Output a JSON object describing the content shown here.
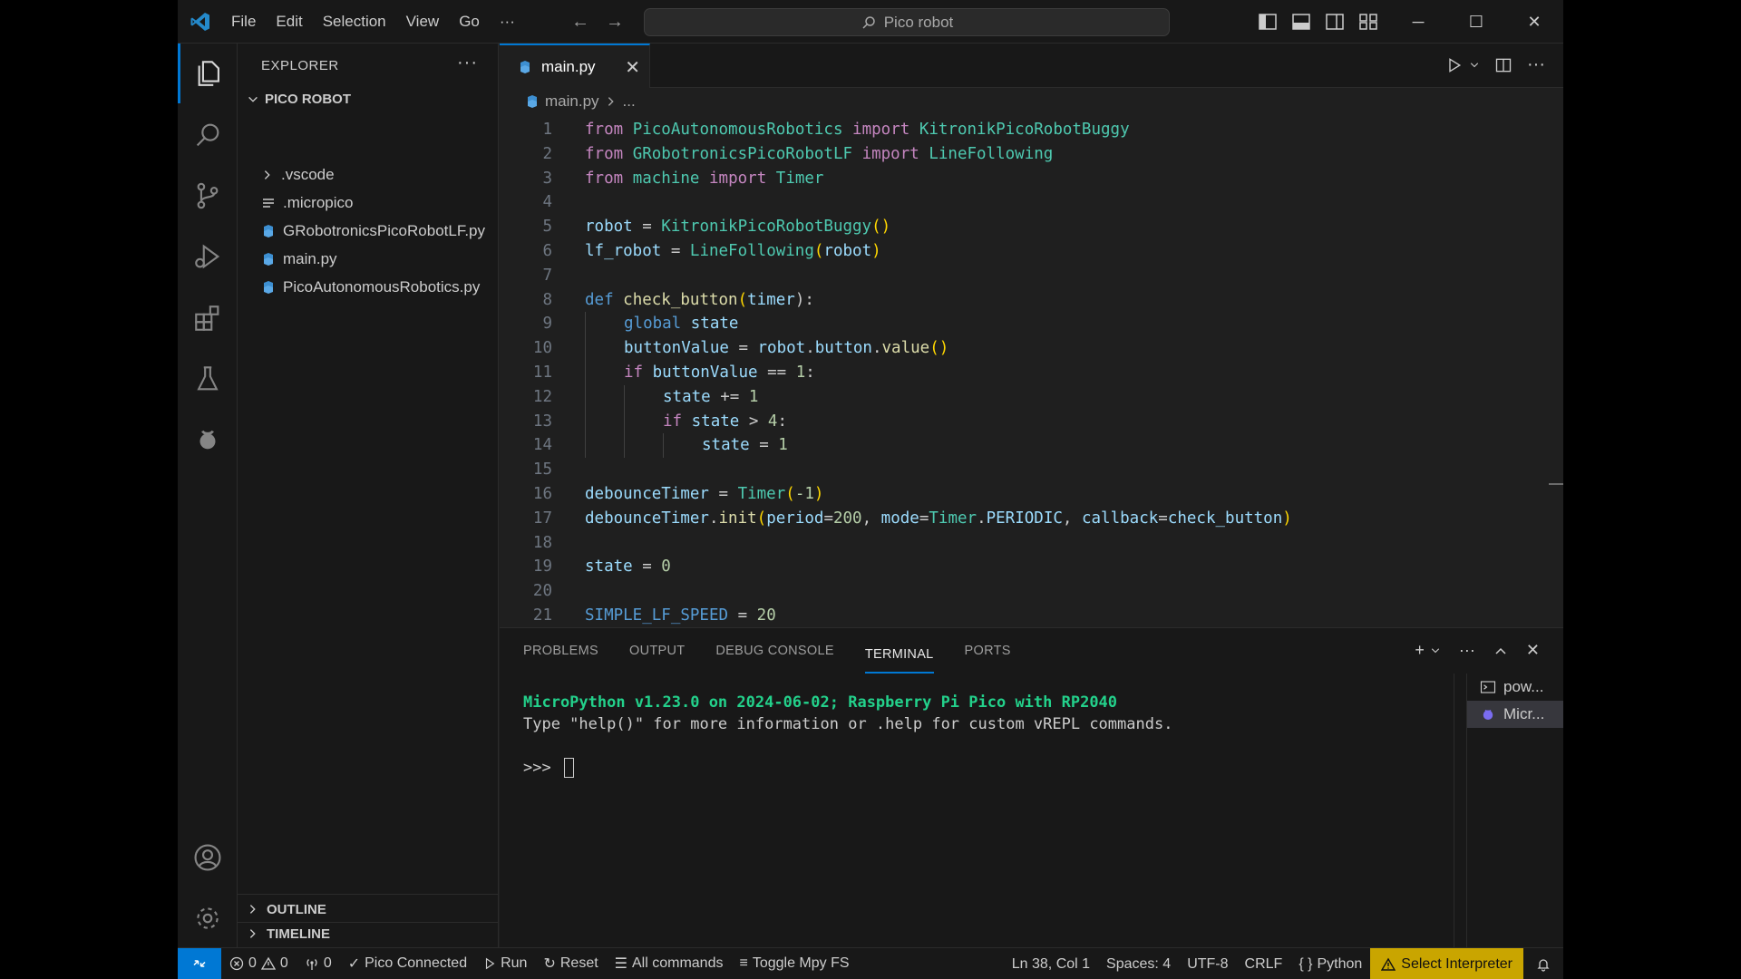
{
  "titlebar": {
    "menu": [
      "File",
      "Edit",
      "Selection",
      "View",
      "Go",
      "···"
    ],
    "search_text": "Pico robot"
  },
  "sidebar": {
    "header": "EXPLORER",
    "more": "···",
    "folder": "PICO ROBOT",
    "items": [
      {
        "label": ".vscode",
        "kind": "folder"
      },
      {
        "label": ".micropico",
        "kind": "file"
      },
      {
        "label": "GRobotronicsPicoRobotLF.py",
        "kind": "python"
      },
      {
        "label": "main.py",
        "kind": "python"
      },
      {
        "label": "PicoAutonomousRobotics.py",
        "kind": "python"
      }
    ],
    "outline": "OUTLINE",
    "timeline": "TIMELINE"
  },
  "editor": {
    "tab_label": "main.py",
    "breadcrumb_file": "main.py",
    "breadcrumb_more": "...",
    "line_numbers": [
      "1",
      "2",
      "3",
      "4",
      "5",
      "6",
      "7",
      "8",
      "9",
      "10",
      "11",
      "12",
      "13",
      "14",
      "15",
      "16",
      "17",
      "18",
      "19",
      "20",
      "21"
    ],
    "code": {
      "l1": [
        "from",
        "PicoAutonomousRobotics",
        "import",
        "KitronikPicoRobotBuggy"
      ],
      "l2": [
        "from",
        "GRobotronicsPicoRobotLF",
        "import",
        "LineFollowing"
      ],
      "l3": [
        "from",
        "machine",
        "import",
        "Timer"
      ],
      "l5": [
        "robot",
        " = ",
        "KitronikPicoRobotBuggy",
        "()"
      ],
      "l6": [
        "lf_robot",
        " = ",
        "LineFollowing",
        "(",
        "robot",
        ")"
      ],
      "l8": [
        "def",
        "check_button",
        "(",
        "timer",
        "):"
      ],
      "l9": [
        "global",
        "state"
      ],
      "l10": [
        "buttonValue",
        " = ",
        "robot",
        ".",
        "button",
        ".",
        "value",
        "()"
      ],
      "l11": [
        "if",
        "buttonValue",
        " == ",
        "1",
        ":"
      ],
      "l12": [
        "state",
        " += ",
        "1"
      ],
      "l13": [
        "if",
        "state",
        " > ",
        "4",
        ":"
      ],
      "l14": [
        "state",
        " = ",
        "1"
      ],
      "l16": [
        "debounceTimer",
        " = ",
        "Timer",
        "(",
        "-1",
        ")"
      ],
      "l17": [
        "debounceTimer",
        ".",
        "init",
        "(",
        "period",
        "=",
        "200",
        ", ",
        "mode",
        "=",
        "Timer",
        ".",
        "PERIODIC",
        ", ",
        "callback",
        "=",
        "check_button",
        ")"
      ],
      "l19": [
        "state",
        " = ",
        "0"
      ],
      "l21": [
        "SIMPLE_LF_SPEED",
        " = ",
        "20"
      ]
    }
  },
  "panel": {
    "tabs": [
      "PROBLEMS",
      "OUTPUT",
      "DEBUG CONSOLE",
      "TERMINAL",
      "PORTS"
    ],
    "active_tab": "TERMINAL",
    "terminal_line1": "MicroPython v1.23.0 on 2024-06-02; Raspberry Pi Pico with RP2040",
    "terminal_line2": "Type \"help()\" for more information or .help for custom vREPL commands.",
    "prompt": ">>> ",
    "terminals": [
      "pow...",
      "Micr..."
    ]
  },
  "statusbar": {
    "errors": "0",
    "warnings": "0",
    "ports": "0",
    "pico": "Pico Connected",
    "run": "Run",
    "reset": "Reset",
    "all_commands": "All commands",
    "toggle_fs": "Toggle Mpy FS",
    "position": "Ln 38, Col 1",
    "spaces": "Spaces: 4",
    "encoding": "UTF-8",
    "eol": "CRLF",
    "language": "Python",
    "interpreter": "Select Interpreter"
  },
  "colors": {
    "accent": "#0078d4",
    "warning_bg": "#c9a500",
    "terminal_green": "#23d18b"
  }
}
